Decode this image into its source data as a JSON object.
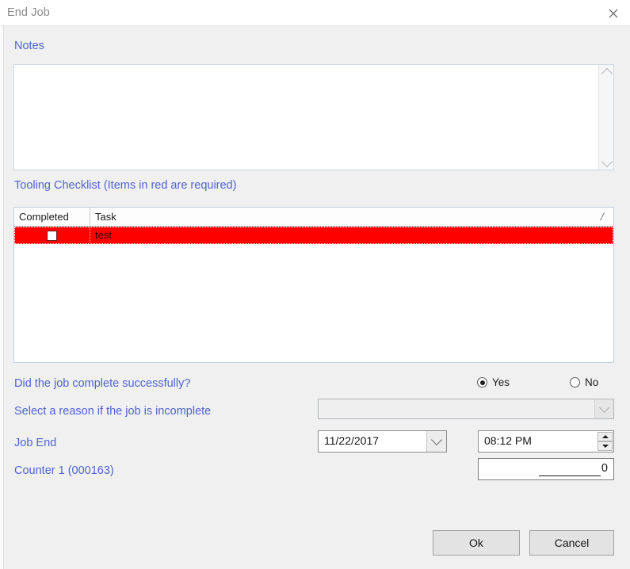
{
  "window": {
    "title": "End Job",
    "close_icon": "close-icon"
  },
  "notes": {
    "label": "Notes",
    "value": "",
    "placeholder": "",
    "scroll_up_icon": "chevron-up-icon",
    "scroll_down_icon": "chevron-down-icon"
  },
  "checklist": {
    "label": "Tooling Checklist (Items in red are required)",
    "columns": [
      "Completed",
      "Task"
    ],
    "resize_glyph": "/",
    "rows": [
      {
        "completed": false,
        "task": "test",
        "required": true
      }
    ]
  },
  "form": {
    "success_question_label": "Did the job complete successfully?",
    "reason_label": "Select a reason if the job is incomplete",
    "job_end_label": "Job End",
    "counter_label": "Counter 1 (000163)",
    "radio_yes_label": "Yes",
    "radio_no_label": "No",
    "radio_selected": "Yes",
    "reason_value": "",
    "reason_options": [],
    "reason_disabled": true,
    "date_value": "11/22/2017",
    "time_value": "08:12 PM",
    "counter_value": "0"
  },
  "actions": {
    "ok_label": "Ok",
    "cancel_label": "Cancel"
  },
  "colors": {
    "label_blue": "#4e63d2",
    "required_red": "#fd0000",
    "dialog_bg": "#f0f0f0",
    "titlebar_bg": "#ffffff"
  }
}
